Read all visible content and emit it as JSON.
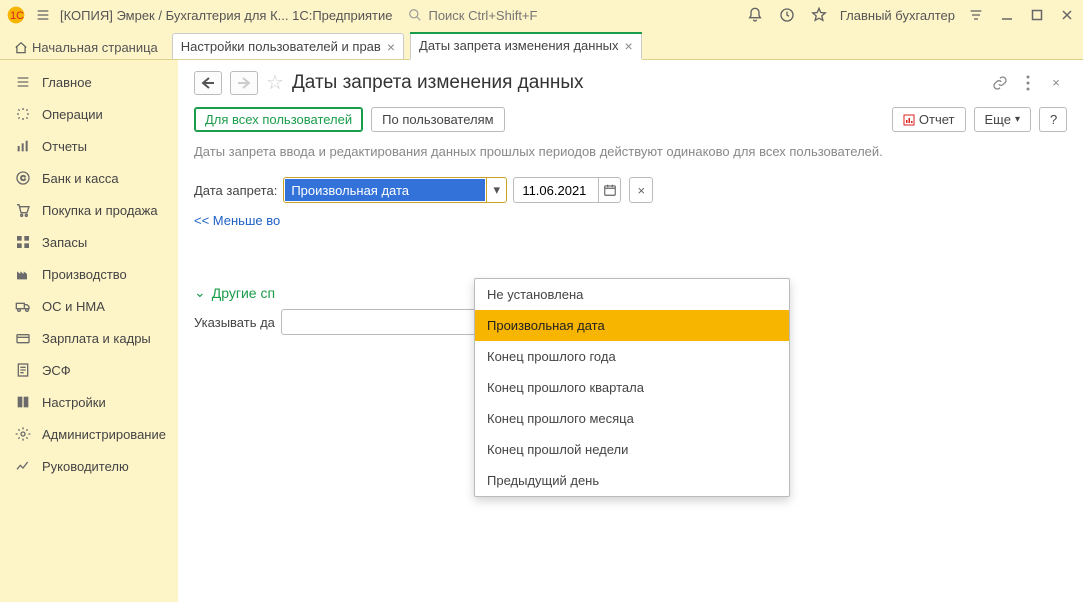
{
  "titlebar": {
    "app_title": "[КОПИЯ] Эмрек / Бухгалтерия для К...   1С:Предприятие",
    "search_placeholder": "Поиск Ctrl+Shift+F",
    "user_label": "Главный бухгалтер"
  },
  "tabs": {
    "home": "Начальная страница",
    "items": [
      {
        "label": "Настройки пользователей и прав"
      },
      {
        "label": "Даты запрета изменения данных"
      }
    ]
  },
  "sidebar": {
    "items": [
      {
        "label": "Главное",
        "icon": "menu"
      },
      {
        "label": "Операции",
        "icon": "ops"
      },
      {
        "label": "Отчеты",
        "icon": "reports"
      },
      {
        "label": "Банк и касса",
        "icon": "bank"
      },
      {
        "label": "Покупка и продажа",
        "icon": "cart"
      },
      {
        "label": "Запасы",
        "icon": "stock"
      },
      {
        "label": "Производство",
        "icon": "factory"
      },
      {
        "label": "ОС и НМА",
        "icon": "truck"
      },
      {
        "label": "Зарплата и кадры",
        "icon": "salary"
      },
      {
        "label": "ЭСФ",
        "icon": "esf"
      },
      {
        "label": "Настройки",
        "icon": "settings"
      },
      {
        "label": "Администрирование",
        "icon": "admin"
      },
      {
        "label": "Руководителю",
        "icon": "manager"
      }
    ]
  },
  "page": {
    "title": "Даты запрета изменения данных",
    "for_all_users": "Для всех пользователей",
    "by_users": "По пользователям",
    "report_btn": "Отчет",
    "more_btn": "Еще",
    "help_btn": "?",
    "info": "Даты запрета ввода и редактирования данных прошлых периодов действуют одинаково для всех пользователей.",
    "date_label": "Дата запрета:",
    "combo_value": "Произвольная дата",
    "date_value": "11.06.2021",
    "less_link": "<< Меньше во",
    "section_title": "Другие сп",
    "sub_label": "Указывать да"
  },
  "dropdown": {
    "options": [
      "Не установлена",
      "Произвольная дата",
      "Конец прошлого года",
      "Конец прошлого квартала",
      "Конец прошлого месяца",
      "Конец прошлой недели",
      "Предыдущий день"
    ],
    "selected_index": 1
  }
}
